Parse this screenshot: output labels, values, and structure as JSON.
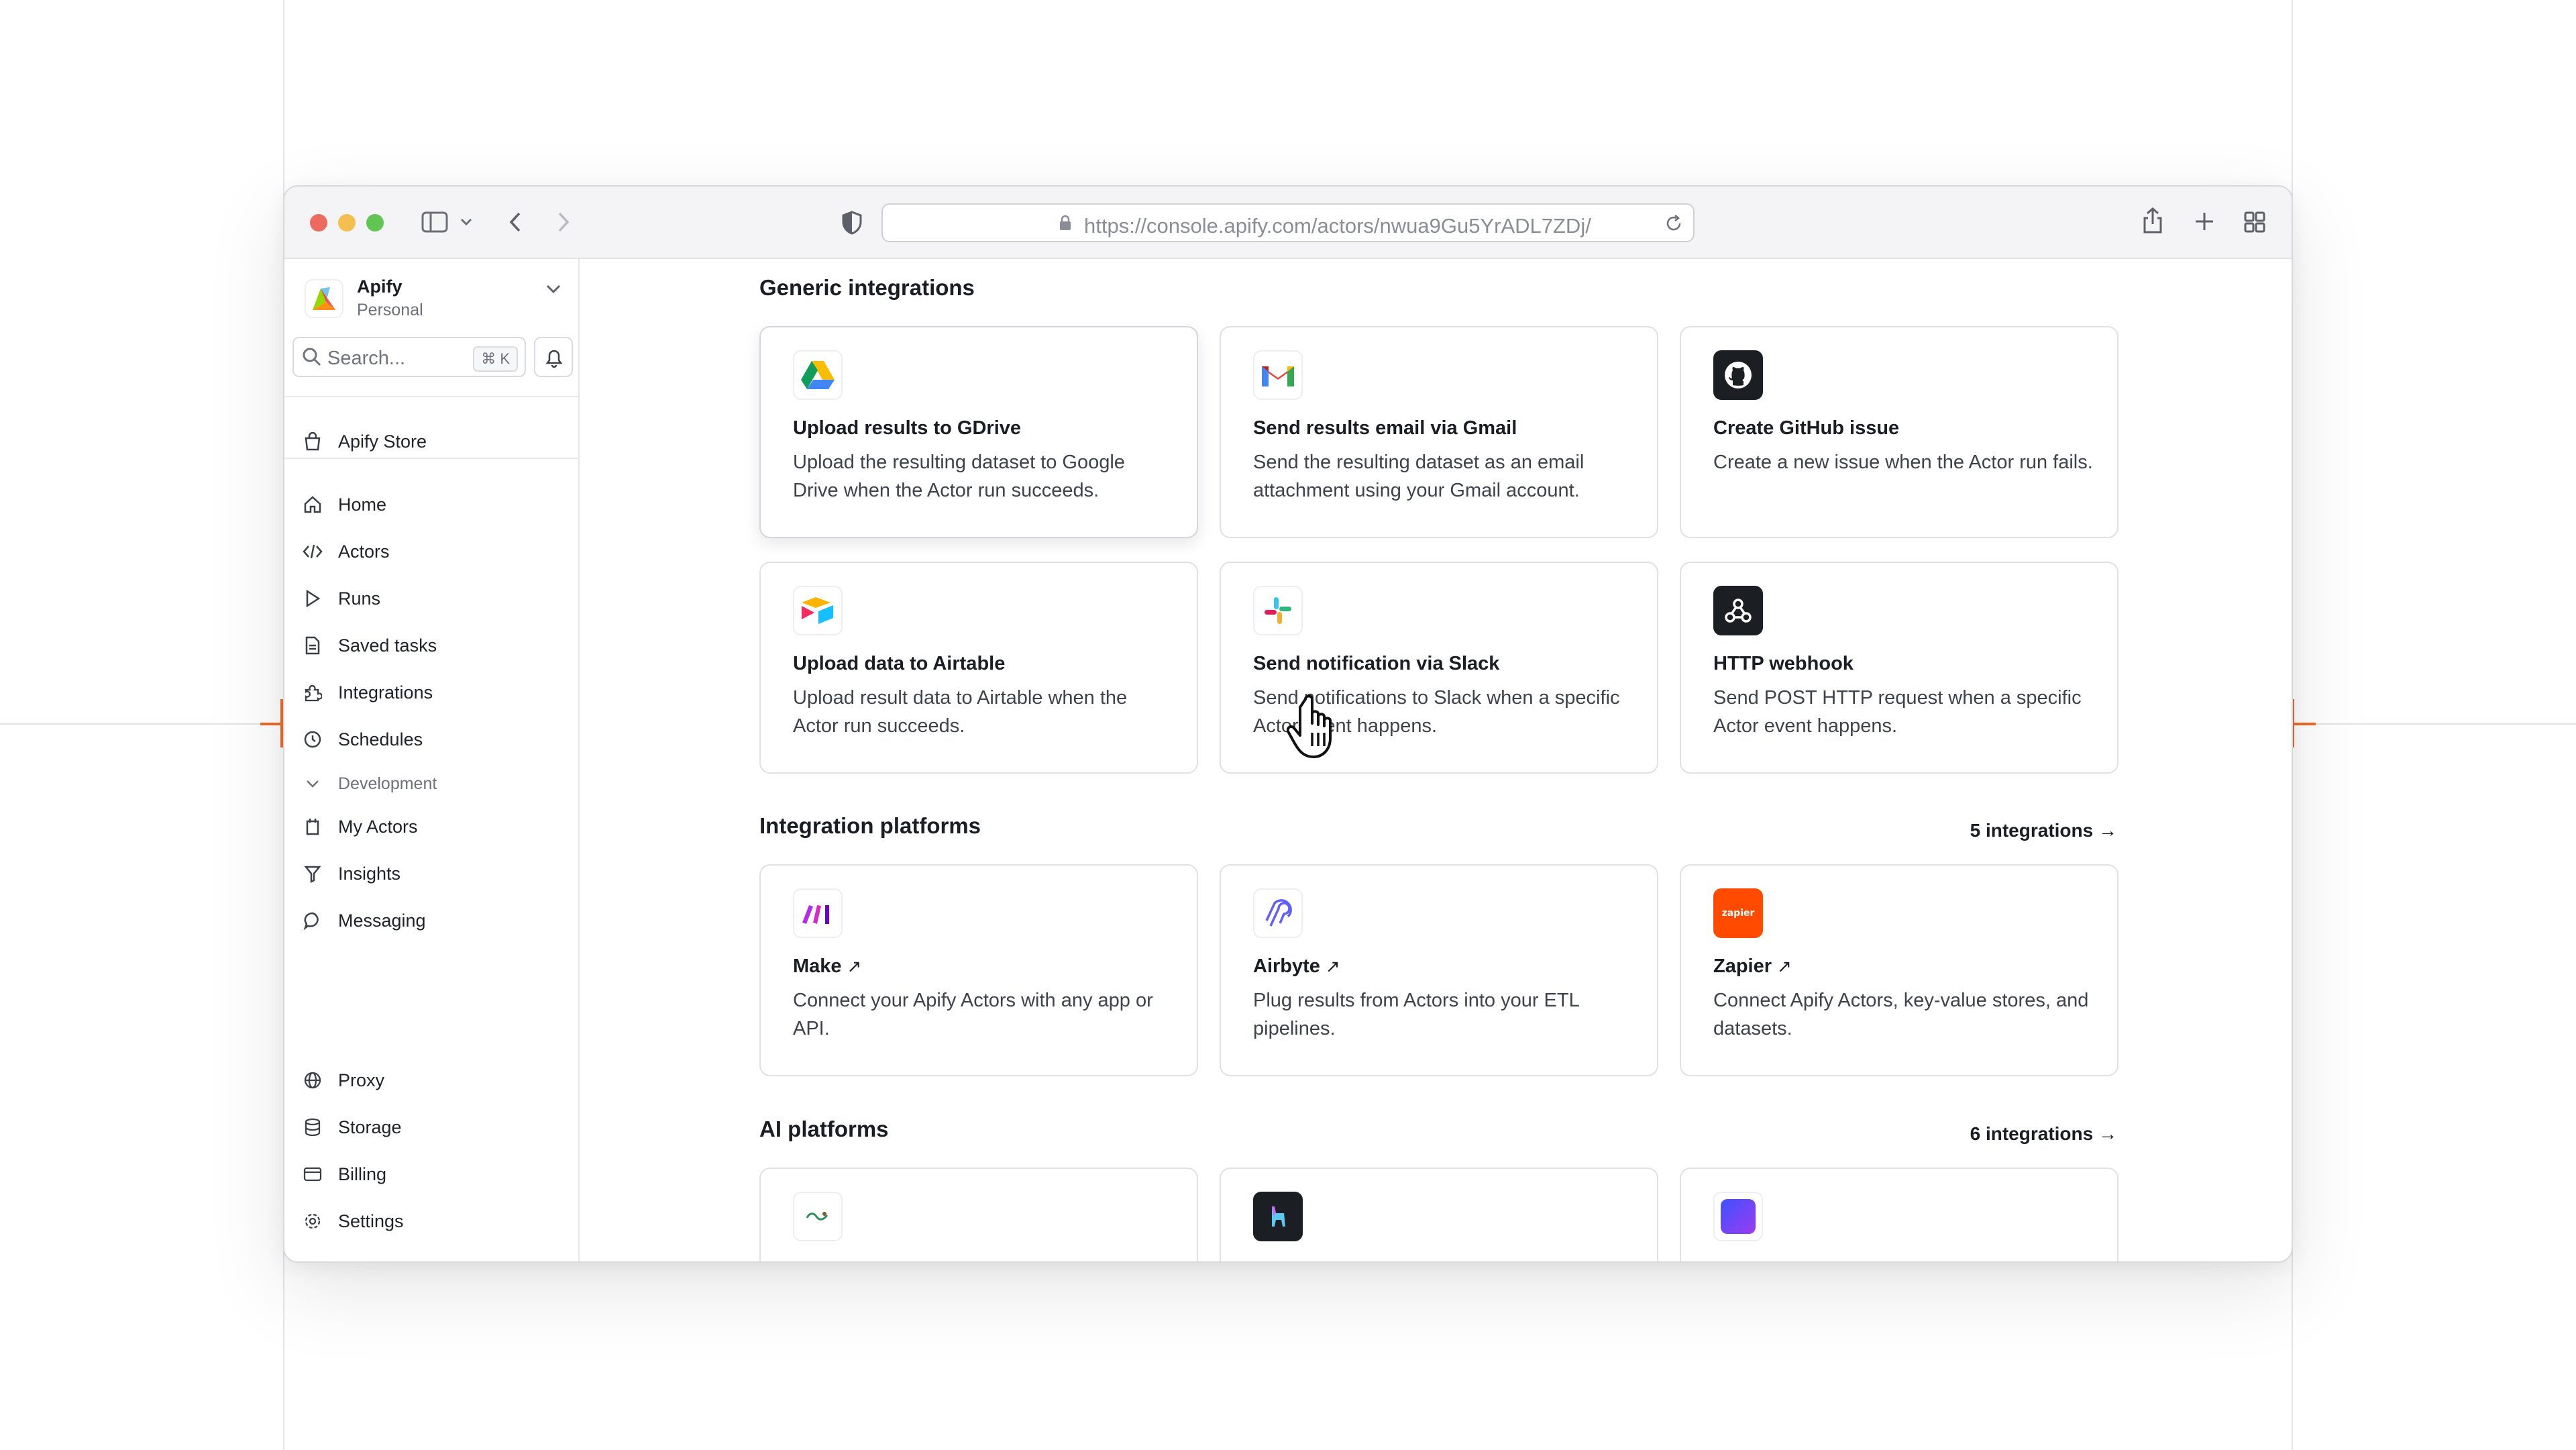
{
  "browser": {
    "url": "https://console.apify.com/actors/nwua9Gu5YrADL7ZDj/"
  },
  "sidebar": {
    "org_name": "Apify",
    "org_sub": "Personal",
    "search_placeholder": "Search...",
    "search_shortcut": "⌘ K",
    "store_label": "Apify Store",
    "items": [
      {
        "label": "Home",
        "icon": "home-icon"
      },
      {
        "label": "Actors",
        "icon": "code-icon"
      },
      {
        "label": "Runs",
        "icon": "play-icon"
      },
      {
        "label": "Saved tasks",
        "icon": "document-icon"
      },
      {
        "label": "Integrations",
        "icon": "puzzle-icon"
      },
      {
        "label": "Schedules",
        "icon": "clock-icon"
      }
    ],
    "dev_section": "Development",
    "dev_items": [
      {
        "label": "My Actors",
        "icon": "actor-icon"
      },
      {
        "label": "Insights",
        "icon": "filter-icon"
      },
      {
        "label": "Messaging",
        "icon": "chat-icon"
      }
    ],
    "bottom_items": [
      {
        "label": "Proxy",
        "icon": "globe-icon"
      },
      {
        "label": "Storage",
        "icon": "database-icon"
      },
      {
        "label": "Billing",
        "icon": "card-icon"
      },
      {
        "label": "Settings",
        "icon": "gear-icon"
      }
    ]
  },
  "main": {
    "generic": {
      "title": "Generic integrations",
      "cards": [
        {
          "title": "Upload results to GDrive",
          "desc": "Upload the resulting dataset to Google Drive when the Actor run succeeds."
        },
        {
          "title": "Send results email via Gmail",
          "desc": "Send the resulting dataset as an email attachment using your Gmail account."
        },
        {
          "title": "Create GitHub issue",
          "desc": "Create a new issue when the Actor run fails."
        },
        {
          "title": "Upload data to Airtable",
          "desc": "Upload result data to Airtable when the Actor run succeeds."
        },
        {
          "title": "Send notification via Slack",
          "desc": "Send notifications to Slack when a specific Actor event happens."
        },
        {
          "title": "HTTP webhook",
          "desc": "Send POST HTTP request when a specific Actor event happens."
        }
      ]
    },
    "platforms": {
      "title": "Integration platforms",
      "link": "5 integrations →",
      "cards": [
        {
          "title": "Make",
          "desc": "Connect your Apify Actors with any app or API."
        },
        {
          "title": "Airbyte",
          "desc": "Plug results from Actors into your ETL pipelines."
        },
        {
          "title": "Zapier",
          "desc": "Connect Apify Actors, key-value stores, and datasets."
        }
      ],
      "zapier_logo_text": "zapier"
    },
    "ai": {
      "title": "AI platforms",
      "link": "6 integrations →"
    }
  }
}
